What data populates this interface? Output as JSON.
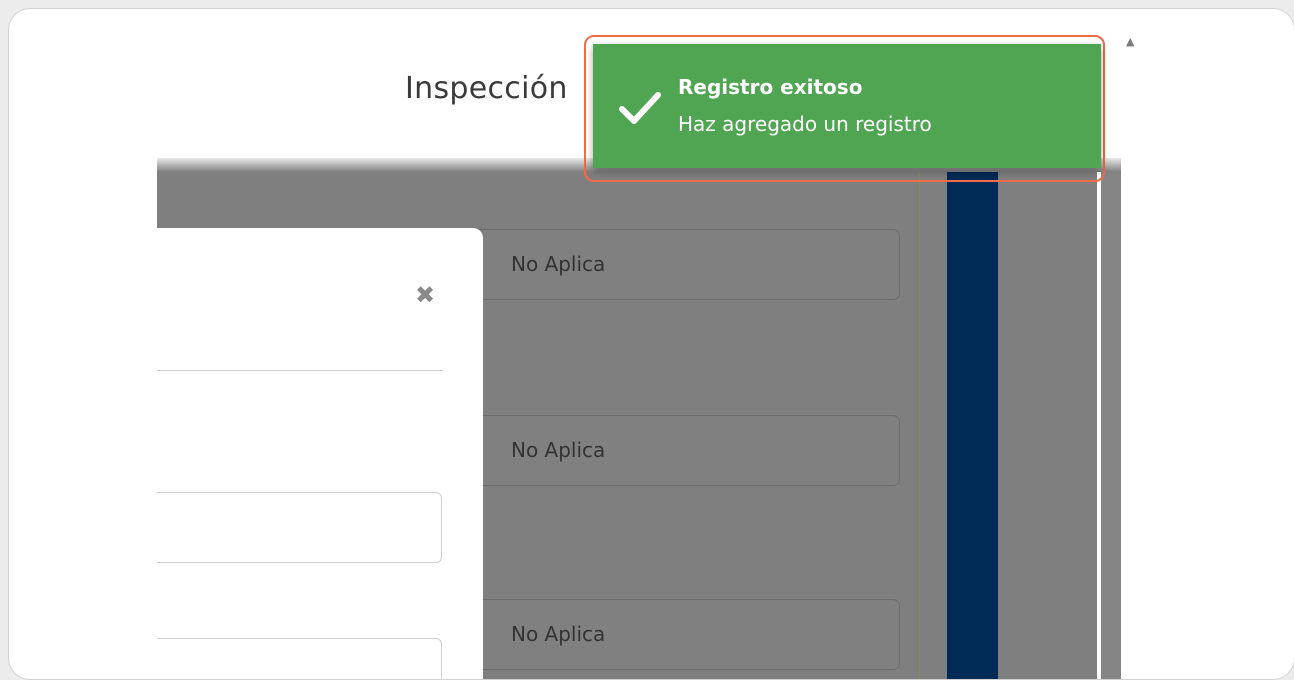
{
  "page": {
    "title": "Inspección"
  },
  "background_form": {
    "fields": [
      {
        "value": "No Aplica"
      },
      {
        "value": "No Aplica"
      },
      {
        "value": "No Aplica"
      }
    ]
  },
  "modal": {
    "close_icon": "close-icon",
    "close_glyph": "✖"
  },
  "toast": {
    "title": "Registro exitoso",
    "message": "Haz agregado un registro",
    "icon": "checkmark-icon",
    "color": "#4fa551",
    "highlight_color": "#ef6c4a"
  },
  "scrollbar": {
    "up_glyph": "▲"
  },
  "colors": {
    "overlay": "#7f7f7f",
    "nav_bar": "#002b57"
  }
}
